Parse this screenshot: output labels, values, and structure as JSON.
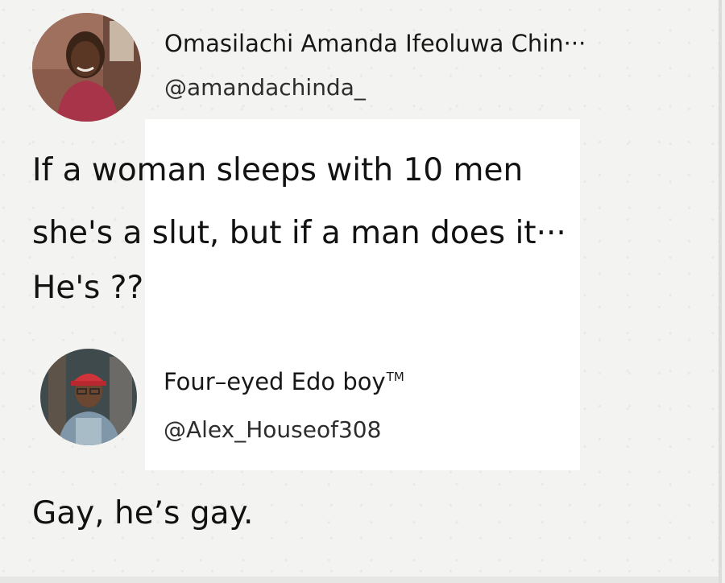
{
  "first_tweet": {
    "display_name": "Omasilachi Amanda Ifeoluwa Chin···",
    "handle": "@amandachinda_",
    "lines": [
      "If a woman sleeps with 10 men",
      "she's a slut, but if a man does it···",
      "He's ??"
    ],
    "avatar_icon": "profile-photo-woman-red-top"
  },
  "reply_tweet": {
    "display_name": "Four–eyed Edo boy",
    "name_suffix": "TM",
    "handle": "@Alex_Houseof308",
    "text": "Gay, he’s gay.",
    "avatar_icon": "profile-photo-man-red-cap"
  },
  "colors": {
    "background": "#f3f3f1",
    "panel": "#ffffff",
    "text": "#141414"
  }
}
